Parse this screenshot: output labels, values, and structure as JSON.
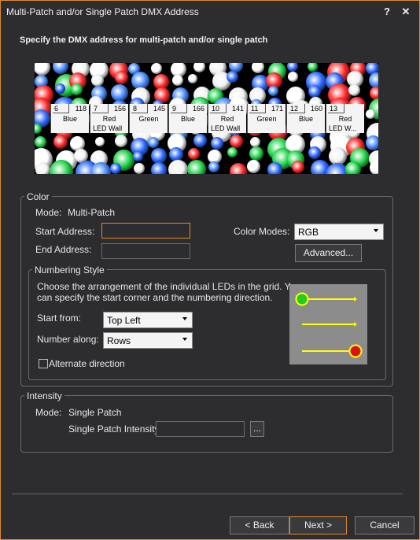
{
  "window": {
    "title": "Multi-Patch and/or Single Patch DMX Address",
    "help_label": "?",
    "close_label": "✕"
  },
  "heading": "Specify the DMX address for multi-patch and/or single patch",
  "preview": {
    "cells": [
      {
        "num": "6",
        "value": "118",
        "color": "Blue",
        "wall": ""
      },
      {
        "num": "7",
        "value": "156",
        "color": "Red",
        "wall": "LED Wall"
      },
      {
        "num": "8",
        "value": "145",
        "color": "Green",
        "wall": ""
      },
      {
        "num": "9",
        "value": "166",
        "color": "Blue",
        "wall": ""
      },
      {
        "num": "10",
        "value": "141",
        "color": "Red",
        "wall": "LED Wall"
      },
      {
        "num": "11",
        "value": "171",
        "color": "Green",
        "wall": ""
      },
      {
        "num": "12",
        "value": "160",
        "color": "Blue",
        "wall": ""
      },
      {
        "num": "13",
        "value": "",
        "color": "Red",
        "wall": "LED W..."
      }
    ]
  },
  "color_group": {
    "legend": "Color",
    "mode_label": "Mode:",
    "mode_value": "Multi-Patch",
    "start_label": "Start Address:",
    "start_value": "",
    "end_label": "End Address:",
    "end_value": "",
    "color_modes_label": "Color Modes:",
    "color_modes_value": "RGB",
    "advanced_label": "Advanced..."
  },
  "numbering": {
    "legend": "Numbering Style",
    "description_line1": "Choose the arrangement of the individual LEDs in the grid. You",
    "description_line2": "can specify the start corner and the numbering direction.",
    "start_from_label": "Start from:",
    "start_from_value": "Top Left",
    "number_along_label": "Number along:",
    "number_along_value": "Rows",
    "alternate_label": "Alternate direction",
    "alternate_checked": false,
    "start_dot_color": "#22cc22",
    "end_dot_color": "#dd1111",
    "arrow_color": "#ffff00"
  },
  "intensity": {
    "legend": "Intensity",
    "mode_label": "Mode:",
    "mode_value": "Single Patch",
    "sp_intensity_label": "Single Patch Intensity:",
    "sp_intensity_value": "",
    "browse_label": "..."
  },
  "footer": {
    "back_label": "< Back",
    "next_label": "Next >",
    "cancel_label": "Cancel"
  },
  "colors": {
    "accent": "#e08a2c",
    "background": "#2d2d30"
  }
}
